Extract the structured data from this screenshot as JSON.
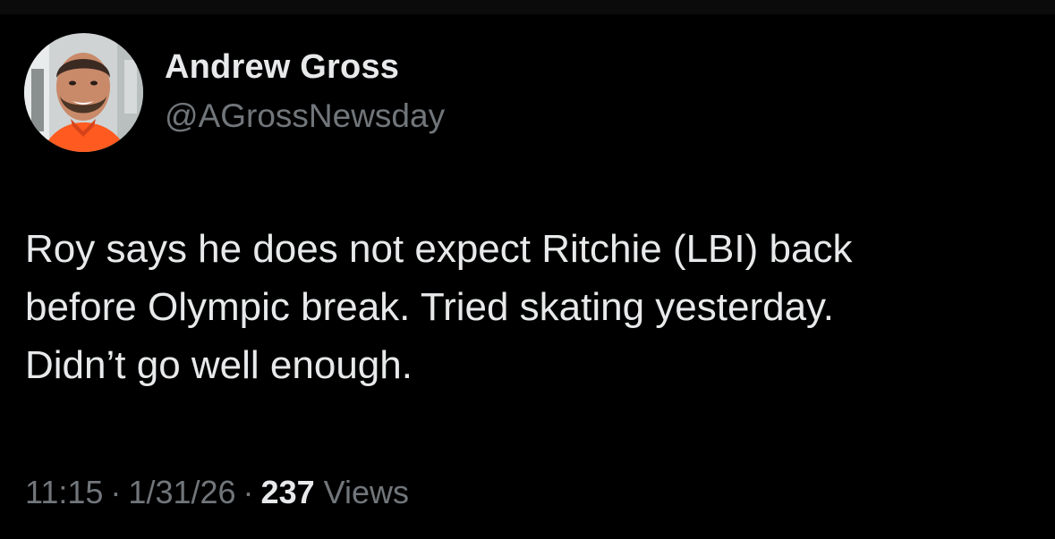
{
  "author": {
    "name": "Andrew Gross",
    "handle": "@AGrossNewsday",
    "avatar_icon": "profile-photo"
  },
  "tweet": {
    "lines": [
      "Roy says he does not expect Ritchie (LBI) back",
      "before Olympic break. Tried skating yesterday.",
      "Didn’t go well enough."
    ]
  },
  "meta": {
    "time": "11:15",
    "separator": "·",
    "date": "1/31/26",
    "views_count": "237",
    "views_label": "Views"
  },
  "colors": {
    "background": "#000000",
    "primary_text": "#e7e9ea",
    "secondary_text": "#71767b",
    "shirt_accent": "#ff5a1f"
  }
}
